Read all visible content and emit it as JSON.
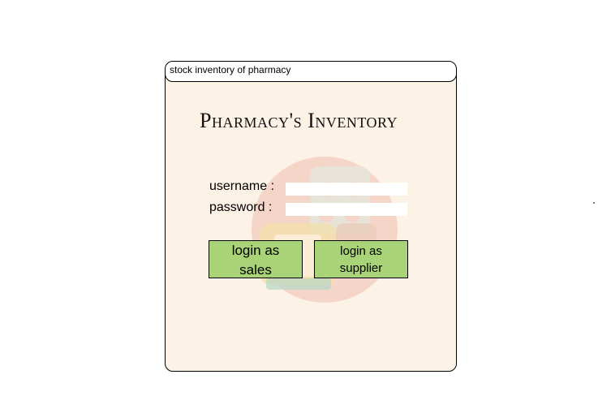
{
  "window": {
    "title": "stock inventory of pharmacy"
  },
  "main": {
    "heading": "Pharmacy's Inventory",
    "logo_icon": "pharmacy-pills-logo-icon",
    "username_label": "username :",
    "username_value": "",
    "password_label": "password :",
    "password_value": "",
    "buttons": [
      {
        "line1": "login as",
        "line2": "sales"
      },
      {
        "line1": "login as",
        "line2": "supplier"
      }
    ]
  },
  "colors": {
    "window_background": "#fdf2e6",
    "button_green": "#a9d377",
    "logo_circle": "#f4c8b8"
  }
}
